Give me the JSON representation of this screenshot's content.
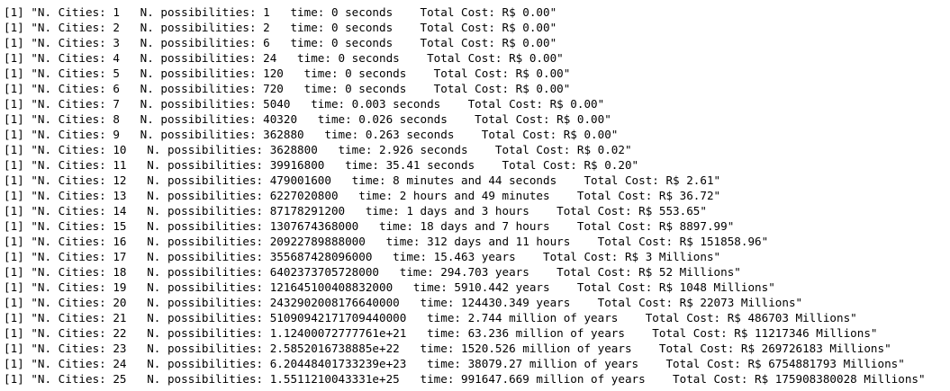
{
  "console": {
    "lines": [
      "[1] \"N. Cities: 1   N. possibilities: 1   time: 0 seconds    Total Cost: R$ 0.00\"",
      "[1] \"N. Cities: 2   N. possibilities: 2   time: 0 seconds    Total Cost: R$ 0.00\"",
      "[1] \"N. Cities: 3   N. possibilities: 6   time: 0 seconds    Total Cost: R$ 0.00\"",
      "[1] \"N. Cities: 4   N. possibilities: 24   time: 0 seconds    Total Cost: R$ 0.00\"",
      "[1] \"N. Cities: 5   N. possibilities: 120   time: 0 seconds    Total Cost: R$ 0.00\"",
      "[1] \"N. Cities: 6   N. possibilities: 720   time: 0 seconds    Total Cost: R$ 0.00\"",
      "[1] \"N. Cities: 7   N. possibilities: 5040   time: 0.003 seconds    Total Cost: R$ 0.00\"",
      "[1] \"N. Cities: 8   N. possibilities: 40320   time: 0.026 seconds    Total Cost: R$ 0.00\"",
      "[1] \"N. Cities: 9   N. possibilities: 362880   time: 0.263 seconds    Total Cost: R$ 0.00\"",
      "[1] \"N. Cities: 10   N. possibilities: 3628800   time: 2.926 seconds    Total Cost: R$ 0.02\"",
      "[1] \"N. Cities: 11   N. possibilities: 39916800   time: 35.41 seconds    Total Cost: R$ 0.20\"",
      "[1] \"N. Cities: 12   N. possibilities: 479001600   time: 8 minutes and 44 seconds    Total Cost: R$ 2.61\"",
      "[1] \"N. Cities: 13   N. possibilities: 6227020800   time: 2 hours and 49 minutes    Total Cost: R$ 36.72\"",
      "[1] \"N. Cities: 14   N. possibilities: 87178291200   time: 1 days and 3 hours    Total Cost: R$ 553.65\"",
      "[1] \"N. Cities: 15   N. possibilities: 1307674368000   time: 18 days and 7 hours    Total Cost: R$ 8897.99\"",
      "[1] \"N. Cities: 16   N. possibilities: 20922789888000   time: 312 days and 11 hours    Total Cost: R$ 151858.96\"",
      "[1] \"N. Cities: 17   N. possibilities: 355687428096000   time: 15.463 years    Total Cost: R$ 3 Millions\"",
      "[1] \"N. Cities: 18   N. possibilities: 6402373705728000   time: 294.703 years    Total Cost: R$ 52 Millions\"",
      "[1] \"N. Cities: 19   N. possibilities: 121645100408832000   time: 5910.442 years    Total Cost: R$ 1048 Millions\"",
      "[1] \"N. Cities: 20   N. possibilities: 2432902008176640000   time: 124430.349 years    Total Cost: R$ 22073 Millions\"",
      "[1] \"N. Cities: 21   N. possibilities: 51090942171709440000   time: 2.744 million of years    Total Cost: R$ 486703 Millions\"",
      "[1] \"N. Cities: 22   N. possibilities: 1.12400072777761e+21   time: 63.236 million of years    Total Cost: R$ 11217346 Millions\"",
      "[1] \"N. Cities: 23   N. possibilities: 2.5852016738885e+22   time: 1520.526 million of years    Total Cost: R$ 269726183 Millions\"",
      "[1] \"N. Cities: 24   N. possibilities: 6.20448401733239e+23   time: 38079.27 million of years    Total Cost: R$ 6754881793 Millions\"",
      "[1] \"N. Cities: 25   N. possibilities: 1.5511210043331e+25   time: 991647.669 million of years    Total Cost: R$ 175908380028 Millions\""
    ]
  }
}
